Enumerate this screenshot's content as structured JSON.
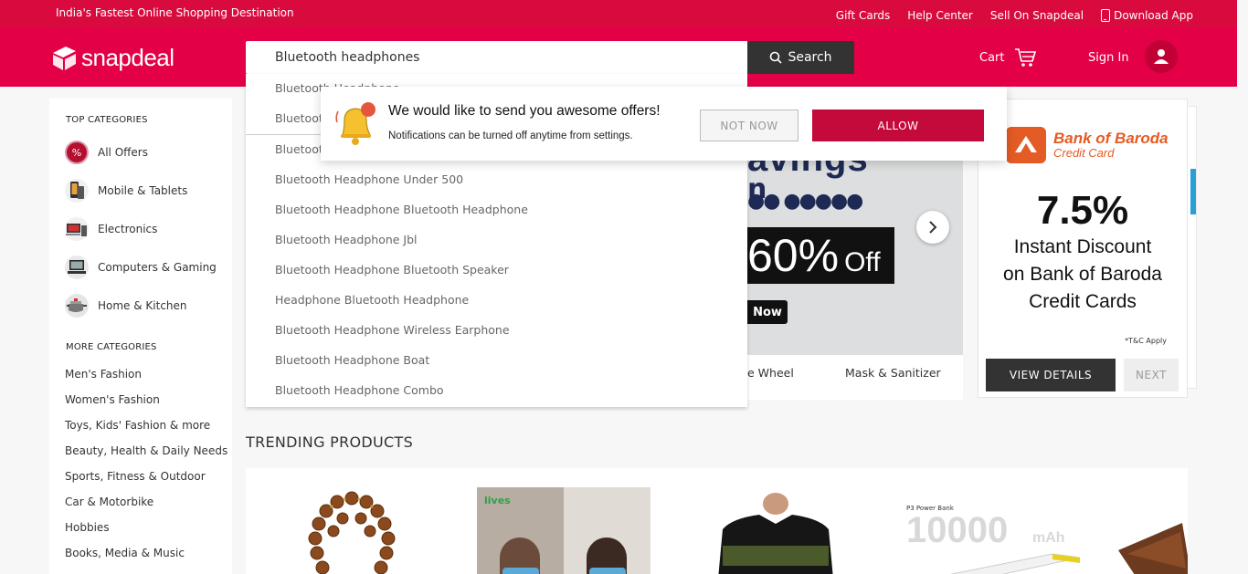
{
  "topstrip": {
    "tagline": "India's Fastest Online Shopping Destination",
    "links": [
      "Gift Cards",
      "Help Center",
      "Sell On Snapdeal",
      "Download App"
    ]
  },
  "header": {
    "logo_text": "snapdeal",
    "search_value": "Bluetooth headphones",
    "search_button": "Search",
    "cart_label": "Cart",
    "signin_label": "Sign In"
  },
  "sidebar": {
    "top_heading": "TOP CATEGORIES",
    "top_categories": [
      {
        "label": "All Offers",
        "icon": "percent-icon"
      },
      {
        "label": "Mobile & Tablets",
        "icon": "mobile-icon"
      },
      {
        "label": "Electronics",
        "icon": "electronics-icon"
      },
      {
        "label": "Computers & Gaming",
        "icon": "computer-icon"
      },
      {
        "label": "Home & Kitchen",
        "icon": "kitchen-icon"
      }
    ],
    "more_heading": "MORE CATEGORIES",
    "more_categories": [
      "Men's Fashion",
      "Women's Fashion",
      "Toys, Kids' Fashion & more",
      "Beauty, Health & Daily Needs",
      "Sports, Fitness & Outdoor",
      "Car & Motorbike",
      "Hobbies",
      "Books, Media & Music"
    ]
  },
  "suggestions": [
    "Bluetooth Headphone",
    "Bluetoot",
    "Bluetoot",
    "Bluetooth Headphone Under 500",
    "Bluetooth Headphone Bluetooth Headphone",
    "Bluetooth Headphone Jbl",
    "Bluetooth Headphone Bluetooth Speaker",
    "Headphone Bluetooth Headphone",
    "Bluetooth Headphone Wireless Earphone",
    "Bluetooth Headphone Boat",
    "Bluetooth Headphone Combo"
  ],
  "banner": {
    "headline": "avings",
    "sub": "n",
    "discount": "60%",
    "off": "Off",
    "cta": "Now",
    "tabs": [
      "e Wheel",
      "Mask & Sanitizer"
    ]
  },
  "promo": {
    "bank_name": "Bank of Baroda",
    "card_type": "Credit Card",
    "percent": "7.5%",
    "lines": [
      "Instant Discount",
      "on Bank of Baroda",
      "Credit Cards"
    ],
    "tnc": "*T&C Apply",
    "view_details": "VIEW DETAILS",
    "next": "NEXT"
  },
  "notification": {
    "title": "We would like to send you awesome offers!",
    "subtitle": "Notifications can be turned off anytime from settings.",
    "not_now": "NOT NOW",
    "allow": "ALLOW"
  },
  "trending": {
    "title": "TRENDING PRODUCTS",
    "powerbank_label": "P3 Power Bank",
    "powerbank_capacity": "10000",
    "powerbank_unit": "mAh",
    "mask_brand": "lives"
  },
  "colors": {
    "brand": "#e40046",
    "topstrip": "#d90b3e",
    "allow_button": "#c4093b",
    "dark_button": "#333333"
  }
}
